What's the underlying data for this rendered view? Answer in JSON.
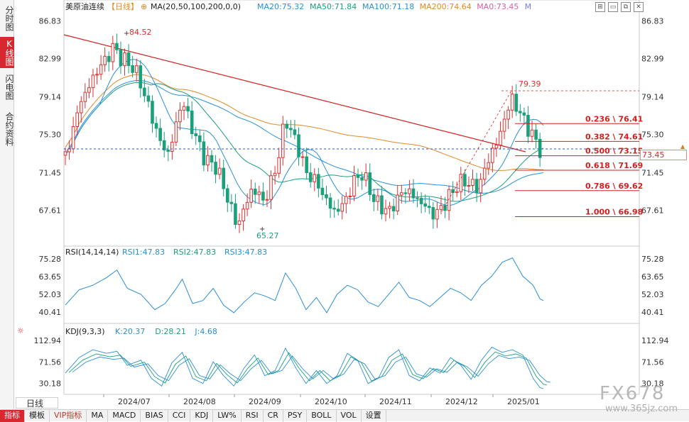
{
  "sidebar": {
    "tabs": [
      {
        "label": "分时图",
        "active": false
      },
      {
        "label": "K线图",
        "active": true
      },
      {
        "label": "闪电图",
        "active": false
      },
      {
        "label": "合约资料",
        "active": false
      }
    ]
  },
  "header": {
    "instrument": "美原油连续",
    "period": "【日线】",
    "ma_params": "MA(20,50,100,200,0,0)",
    "ma_values": [
      {
        "label": "MA20:75.32",
        "color": "#2a8fd8"
      },
      {
        "label": "MA50:71.84",
        "color": "#1aa07a"
      },
      {
        "label": "MA100:71.18",
        "color": "#2a8fd8"
      },
      {
        "label": "MA200:74.64",
        "color": "#e08a2a"
      },
      {
        "label": "MA0:73.45",
        "color": "#d45fa8"
      },
      {
        "label": "M",
        "color": "#7a7ae0"
      }
    ]
  },
  "controls": {
    "icons": [
      "fit-icon",
      "minimize-icon",
      "restore-icon",
      "close-icon"
    ]
  },
  "y_axis": {
    "main_ticks": [
      "86.83",
      "82.99",
      "79.14",
      "75.30",
      "71.45",
      "67.61"
    ],
    "rsi_ticks": [
      "75.28",
      "63.65",
      "52.03",
      "40.41"
    ],
    "kdj_ticks": [
      "112.94",
      "71.56",
      "30.18"
    ]
  },
  "current_price": "73.45",
  "annotations": {
    "high": "84.52",
    "low": "65.27",
    "recent_high": "79.39"
  },
  "fibonacci": [
    {
      "label": "0.236 \\ 76.41",
      "value": 76.41
    },
    {
      "label": "0.382 \\ 74.61",
      "value": 74.61
    },
    {
      "label": "0.500 \\ 73.15",
      "value": 73.15
    },
    {
      "label": "0.618 \\ 71.69",
      "value": 71.69
    },
    {
      "label": "0.786 \\ 69.62",
      "value": 69.62
    },
    {
      "label": "1.000 \\ 66.98",
      "value": 66.98
    }
  ],
  "rsi": {
    "title": "RSI(14,14,14)",
    "values": [
      {
        "label": "RSI1:47.83",
        "color": "#2a8fd8"
      },
      {
        "label": "RSI2:47.83",
        "color": "#1aa07a"
      },
      {
        "label": "RSI3:47.83",
        "color": "#2a8fd8"
      }
    ]
  },
  "kdj": {
    "title": "KDJ(9,3,3)",
    "values": [
      {
        "label": "K:20.37",
        "color": "#2a8fd8"
      },
      {
        "label": "D:28.21",
        "color": "#1aa07a"
      },
      {
        "label": "J:4.68",
        "color": "#2a8fd8"
      }
    ]
  },
  "x_axis": {
    "labels": [
      "2024/07",
      "2024/08",
      "2024/09",
      "2024/10",
      "2024/11",
      "2024/12",
      "2025/01"
    ]
  },
  "period_selector": "日线",
  "toolbar": {
    "buttons": [
      {
        "label": "指标",
        "active": true
      },
      {
        "label": "模板",
        "active": false
      },
      {
        "label": "VIP指标",
        "active": false,
        "vip": true
      },
      {
        "label": "MA",
        "active": false
      },
      {
        "label": "MACD",
        "active": false
      },
      {
        "label": "BIAS",
        "active": false
      },
      {
        "label": "CCI",
        "active": false
      },
      {
        "label": "KDJ",
        "active": false
      },
      {
        "label": "LW%",
        "active": false
      },
      {
        "label": "RSI",
        "active": false
      },
      {
        "label": "CR",
        "active": false
      },
      {
        "label": "PSY",
        "active": false
      },
      {
        "label": "BOLL",
        "active": false
      },
      {
        "label": "VOL",
        "active": false
      },
      {
        "label": "设置",
        "active": false
      }
    ]
  },
  "watermark": {
    "brand": "FX678",
    "url": "www.365jz.com"
  },
  "colors": {
    "up": "#e03030",
    "down": "#1aa07a",
    "trendline": "#d42020",
    "ma20": "#2a8fd8",
    "ma50": "#1aa07a",
    "ma100": "#2a8fd8",
    "ma200": "#e08a2a"
  },
  "chart_data": {
    "type": "candlestick",
    "ylim": [
      64.5,
      87.5
    ],
    "price_points": [
      [
        0,
        73.2
      ],
      [
        4,
        75.3
      ],
      [
        8,
        78.4
      ],
      [
        12,
        79.6
      ],
      [
        16,
        81.0
      ],
      [
        20,
        82.2
      ],
      [
        24,
        83.0
      ],
      [
        28,
        84.2
      ],
      [
        32,
        83.1
      ],
      [
        36,
        82.6
      ],
      [
        40,
        82.0
      ],
      [
        44,
        80.4
      ],
      [
        48,
        78.3
      ],
      [
        52,
        76.2
      ],
      [
        56,
        74.2
      ],
      [
        60,
        73.4
      ],
      [
        64,
        76.0
      ],
      [
        68,
        78.9
      ],
      [
        72,
        76.7
      ],
      [
        76,
        75.0
      ],
      [
        80,
        73.2
      ],
      [
        84,
        72.4
      ],
      [
        88,
        72.0
      ],
      [
        92,
        70.0
      ],
      [
        96,
        68.0
      ],
      [
        100,
        66.0
      ],
      [
        104,
        67.8
      ],
      [
        108,
        69.6
      ],
      [
        112,
        69.4
      ],
      [
        116,
        68.4
      ],
      [
        120,
        70.7
      ],
      [
        124,
        73.0
      ],
      [
        128,
        77.1
      ],
      [
        132,
        75.2
      ],
      [
        136,
        73.8
      ],
      [
        140,
        71.3
      ],
      [
        144,
        71.0
      ],
      [
        148,
        69.8
      ],
      [
        152,
        68.6
      ],
      [
        156,
        67.5
      ],
      [
        160,
        67.9
      ],
      [
        164,
        69.0
      ],
      [
        168,
        70.6
      ],
      [
        172,
        71.4
      ],
      [
        176,
        70.2
      ],
      [
        180,
        68.5
      ],
      [
        184,
        68.0
      ],
      [
        188,
        67.4
      ],
      [
        192,
        68.5
      ],
      [
        196,
        69.5
      ],
      [
        200,
        69.6
      ],
      [
        204,
        68.7
      ],
      [
        208,
        68.4
      ],
      [
        212,
        67.4
      ],
      [
        216,
        67.3
      ],
      [
        220,
        68.2
      ],
      [
        224,
        69.2
      ],
      [
        228,
        70.2
      ],
      [
        232,
        70.6
      ],
      [
        236,
        70.2
      ],
      [
        240,
        69.9
      ],
      [
        244,
        71.8
      ],
      [
        248,
        73.6
      ],
      [
        252,
        74.8
      ],
      [
        256,
        77.4
      ],
      [
        260,
        78.9
      ],
      [
        264,
        77.6
      ],
      [
        268,
        76.3
      ],
      [
        272,
        75.1
      ],
      [
        276,
        73.8
      ],
      [
        278,
        73.5
      ]
    ],
    "rsi_points": [
      [
        0,
        45
      ],
      [
        8,
        55
      ],
      [
        16,
        58
      ],
      [
        24,
        63
      ],
      [
        30,
        68
      ],
      [
        36,
        56
      ],
      [
        44,
        52
      ],
      [
        52,
        42
      ],
      [
        58,
        46
      ],
      [
        64,
        55
      ],
      [
        68,
        62
      ],
      [
        74,
        46
      ],
      [
        80,
        48
      ],
      [
        86,
        56
      ],
      [
        92,
        45
      ],
      [
        98,
        40
      ],
      [
        104,
        47
      ],
      [
        110,
        53
      ],
      [
        116,
        51
      ],
      [
        122,
        48
      ],
      [
        128,
        66
      ],
      [
        134,
        56
      ],
      [
        140,
        42
      ],
      [
        146,
        50
      ],
      [
        152,
        40
      ],
      [
        158,
        52
      ],
      [
        164,
        58
      ],
      [
        170,
        55
      ],
      [
        176,
        47
      ],
      [
        182,
        44
      ],
      [
        188,
        52
      ],
      [
        194,
        60
      ],
      [
        200,
        50
      ],
      [
        206,
        48
      ],
      [
        212,
        44
      ],
      [
        218,
        50
      ],
      [
        224,
        56
      ],
      [
        230,
        53
      ],
      [
        236,
        48
      ],
      [
        242,
        58
      ],
      [
        248,
        64
      ],
      [
        254,
        73
      ],
      [
        260,
        76
      ],
      [
        266,
        64
      ],
      [
        272,
        58
      ],
      [
        276,
        49
      ],
      [
        278,
        48
      ]
    ],
    "kdj_points": [
      [
        0,
        50
      ],
      [
        8,
        80
      ],
      [
        16,
        95
      ],
      [
        24,
        88
      ],
      [
        30,
        92
      ],
      [
        36,
        65
      ],
      [
        44,
        75
      ],
      [
        50,
        40
      ],
      [
        56,
        25
      ],
      [
        62,
        70
      ],
      [
        68,
        90
      ],
      [
        74,
        40
      ],
      [
        80,
        30
      ],
      [
        86,
        72
      ],
      [
        92,
        45
      ],
      [
        98,
        25
      ],
      [
        104,
        60
      ],
      [
        110,
        85
      ],
      [
        116,
        45
      ],
      [
        122,
        55
      ],
      [
        128,
        98
      ],
      [
        134,
        60
      ],
      [
        140,
        30
      ],
      [
        146,
        55
      ],
      [
        152,
        30
      ],
      [
        158,
        45
      ],
      [
        164,
        88
      ],
      [
        170,
        75
      ],
      [
        176,
        30
      ],
      [
        182,
        40
      ],
      [
        188,
        80
      ],
      [
        194,
        95
      ],
      [
        200,
        45
      ],
      [
        206,
        35
      ],
      [
        212,
        60
      ],
      [
        218,
        50
      ],
      [
        224,
        80
      ],
      [
        230,
        65
      ],
      [
        236,
        38
      ],
      [
        242,
        75
      ],
      [
        248,
        100
      ],
      [
        254,
        90
      ],
      [
        260,
        95
      ],
      [
        266,
        85
      ],
      [
        272,
        40
      ],
      [
        276,
        22
      ],
      [
        278,
        20
      ]
    ]
  }
}
